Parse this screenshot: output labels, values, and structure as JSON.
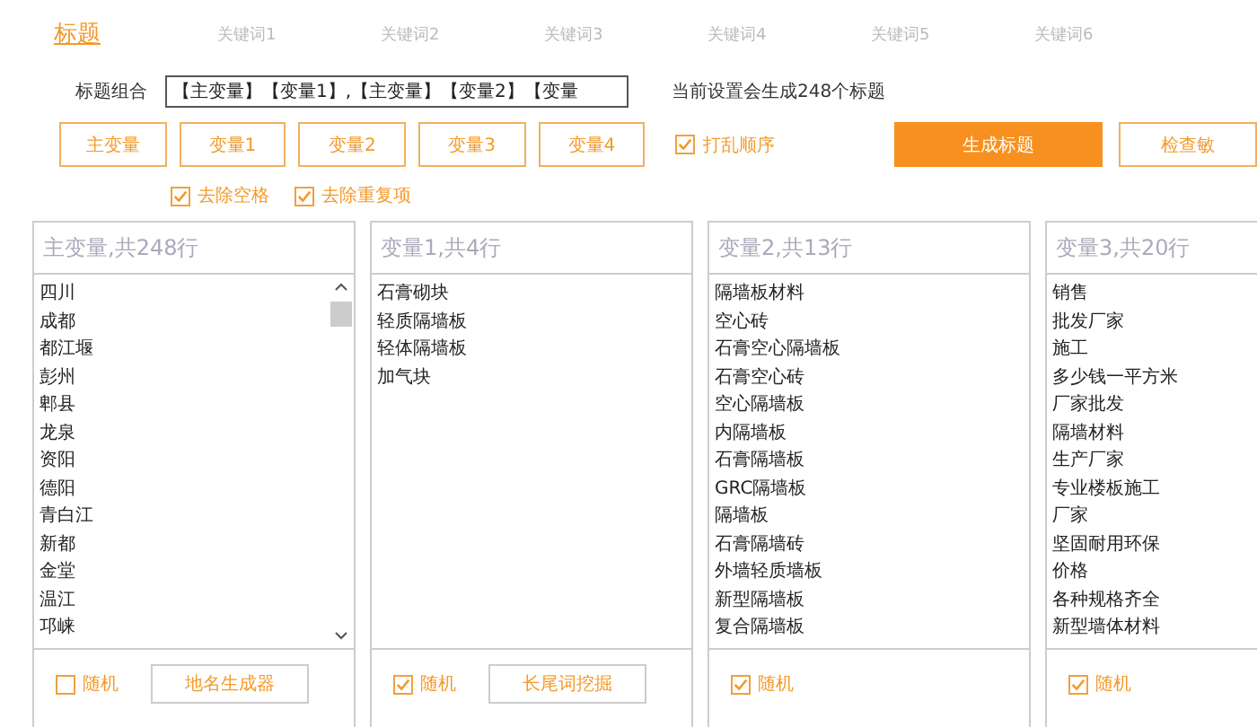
{
  "tabs": [
    {
      "label": "标题",
      "selected": true
    },
    {
      "label": "关键词1",
      "selected": false
    },
    {
      "label": "关键词2",
      "selected": false
    },
    {
      "label": "关键词3",
      "selected": false
    },
    {
      "label": "关键词4",
      "selected": false
    },
    {
      "label": "关键词5",
      "selected": false
    },
    {
      "label": "关键词6",
      "selected": false
    }
  ],
  "combo": {
    "label": "标题组合",
    "value": "【主变量】【变量1】,【主变量】【变量2】【变量",
    "status": "当前设置会生成248个标题"
  },
  "variable_buttons": [
    "主变量",
    "变量1",
    "变量2",
    "变量3",
    "变量4"
  ],
  "shuffle": {
    "label": "打乱顺序",
    "checked": true
  },
  "generate_button": "生成标题",
  "check_button": "检查敏",
  "options": [
    {
      "label": "去除空格",
      "checked": true
    },
    {
      "label": "去除重复项",
      "checked": true
    }
  ],
  "panels": [
    {
      "header": "主变量,共248行",
      "scrollbar": true,
      "items": [
        "四川",
        "成都",
        "都江堰",
        "彭州",
        "郫县",
        "龙泉",
        "资阳",
        "德阳",
        "青白江",
        "新都",
        "金堂",
        "温江",
        "邛崃"
      ],
      "random": {
        "label": "随机",
        "checked": false
      },
      "button": "地名生成器"
    },
    {
      "header": "变量1,共4行",
      "scrollbar": false,
      "items": [
        "石膏砌块",
        "轻质隔墙板",
        "轻体隔墙板",
        "加气块"
      ],
      "random": {
        "label": "随机",
        "checked": true
      },
      "button": "长尾词挖掘"
    },
    {
      "header": "变量2,共13行",
      "scrollbar": false,
      "items": [
        "隔墙板材料",
        "空心砖",
        "石膏空心隔墙板",
        "石膏空心砖",
        "空心隔墙板",
        "内隔墙板",
        "石膏隔墙板",
        "GRC隔墙板",
        "隔墙板",
        "石膏隔墙砖",
        "外墙轻质墙板",
        "新型隔墙板",
        "复合隔墙板"
      ],
      "random": {
        "label": "随机",
        "checked": true
      }
    },
    {
      "header": "变量3,共20行",
      "scrollbar": false,
      "items": [
        "销售",
        "批发厂家",
        "施工",
        "多少钱一平方米",
        "厂家批发",
        "隔墙材料",
        "生产厂家",
        "专业楼板施工",
        "厂家",
        "坚固耐用环保",
        "价格",
        "各种规格齐全",
        "新型墙体材料"
      ],
      "random": {
        "label": "随机",
        "checked": true
      }
    }
  ]
}
